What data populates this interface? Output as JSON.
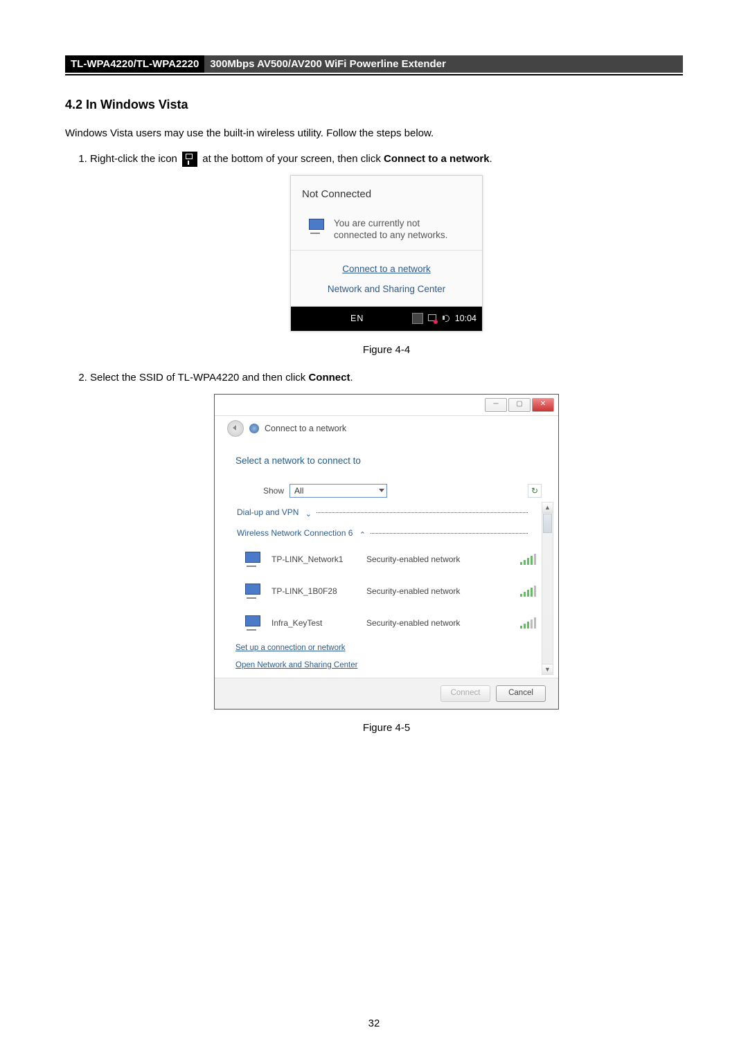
{
  "header": {
    "model": "TL-WPA4220/TL-WPA2220",
    "title": "300Mbps AV500/AV200 WiFi Powerline Extender"
  },
  "section": {
    "heading": "4.2 In Windows Vista",
    "intro": "Windows Vista users may use the built-in wireless utility. Follow the steps below."
  },
  "steps": {
    "step1_a": "Right-click the icon",
    "step1_b": "at the bottom of your screen, then click ",
    "step1_bold": "Connect to a network",
    "step1_end": ".",
    "step2_a": "Select the SSID of TL-WPA4220 and then click ",
    "step2_bold": "Connect",
    "step2_end": "."
  },
  "popup": {
    "title": "Not Connected",
    "message_line1": "You are currently not",
    "message_line2": "connected to any networks.",
    "link1": "Connect to a network",
    "link2": "Network and Sharing Center"
  },
  "taskbar": {
    "lang": "EN",
    "time": "10:04"
  },
  "fig44": "Figure 4-4",
  "dialog": {
    "banner": "Connect to a network",
    "heading": "Select a network to connect to",
    "show_label": "Show",
    "show_value": "All",
    "expanders": {
      "dial": "Dial-up and VPN",
      "wireless": "Wireless Network Connection 6"
    },
    "networks": [
      {
        "name": "TP-LINK_Network1",
        "sec": "Security-enabled network"
      },
      {
        "name": "TP-LINK_1B0F28",
        "sec": "Security-enabled network"
      },
      {
        "name": "Infra_KeyTest",
        "sec": "Security-enabled network"
      }
    ],
    "link_setup": "Set up a connection or network",
    "link_open": "Open Network and Sharing Center",
    "btn_connect": "Connect",
    "btn_cancel": "Cancel"
  },
  "fig45": "Figure 4-5",
  "page_number": "32"
}
